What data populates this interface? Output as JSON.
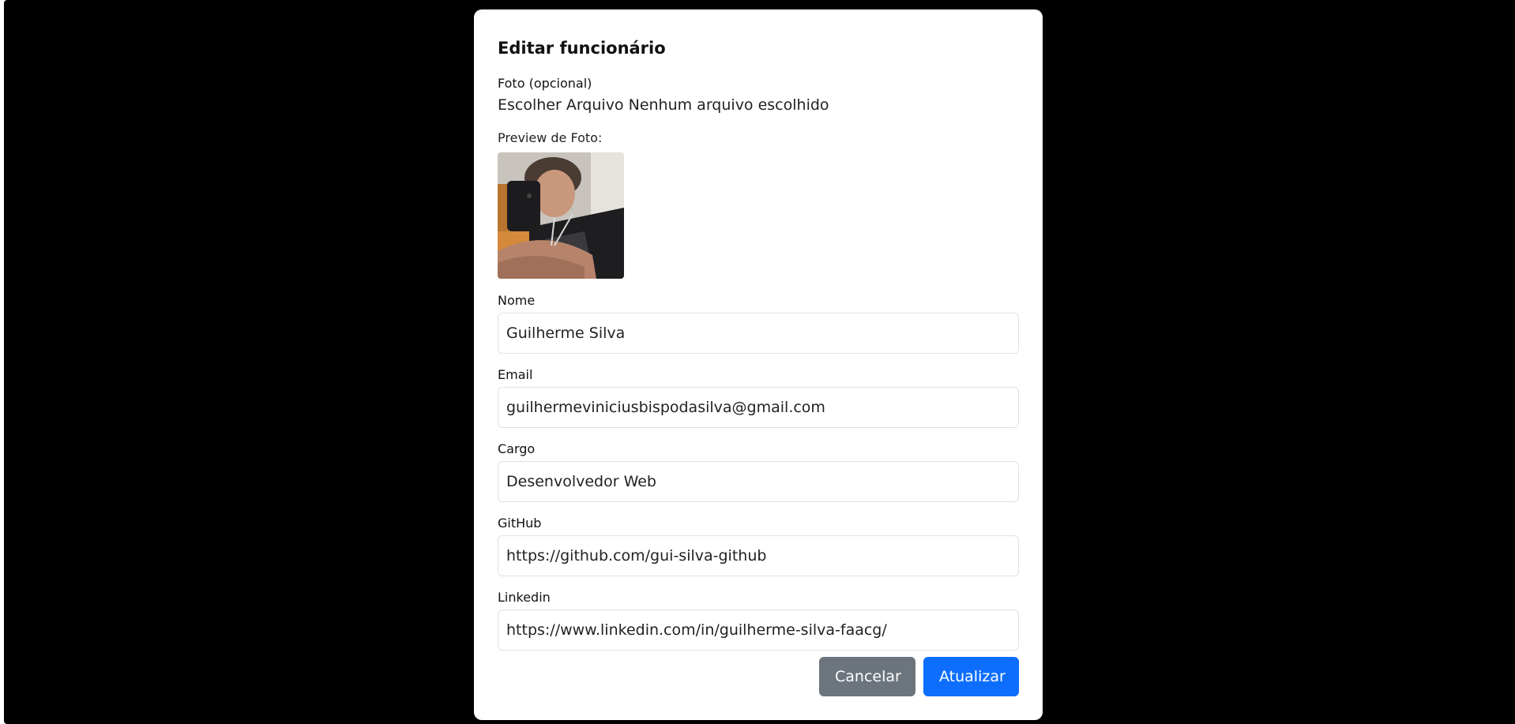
{
  "modal": {
    "title": "Editar funcionário"
  },
  "photo": {
    "label": "Foto (opcional)",
    "choose_button": "Escolher Arquivo",
    "no_file_text": "Nenhum arquivo escolhido",
    "preview_label": "Preview de Foto:"
  },
  "form": {
    "nome": {
      "label": "Nome",
      "value": "Guilherme Silva"
    },
    "email": {
      "label": "Email",
      "value": "guilhermeviniciusbispodasilva@gmail.com"
    },
    "cargo": {
      "label": "Cargo",
      "value": "Desenvolvedor Web"
    },
    "github": {
      "label": "GitHub",
      "value": "https://github.com/gui-silva-github"
    },
    "linkedin": {
      "label": "Linkedin",
      "value": "https://www.linkedin.com/in/guilherme-silva-faacg/"
    }
  },
  "actions": {
    "cancel_label": "Cancelar",
    "update_label": "Atualizar"
  },
  "colors": {
    "backdrop": "#000000",
    "primary": "#0d6efd",
    "secondary": "#6c757d"
  }
}
